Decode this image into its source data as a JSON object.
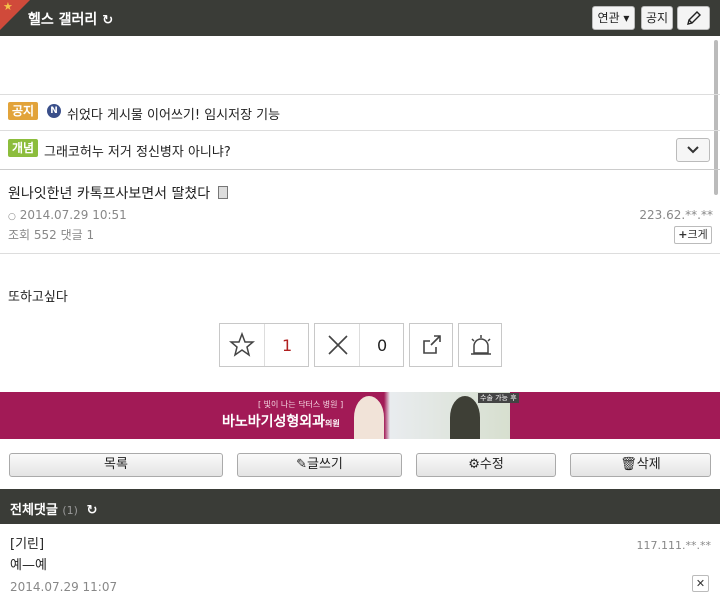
{
  "header": {
    "title": "헬스 갤러리",
    "related_label": "연관 ▾",
    "notice_label": "공지"
  },
  "notice": {
    "badge": "공지",
    "icon_letter": "N",
    "text": "쉬었다 게시물 이어쓰기! 임시저장 기능"
  },
  "concept": {
    "badge": "개념",
    "text": "그래코허누 저거 정신병자 아니냐?"
  },
  "post": {
    "title": "원나잇한년 카톡프사보면서 딸쳤다",
    "date": "2014.07.29 10:51",
    "ip": "223.62.**.**",
    "stats": "조회 552 댓글 1",
    "enlarge_label": "크게",
    "body": "또하고싶다"
  },
  "votes": {
    "recommend_count": "1",
    "reject_count": "0"
  },
  "banner": {
    "small": "[ 빛이 나는 닥터스 병원 ]",
    "main": "바노바기성형외과",
    "sub": "의원",
    "tag": "수술 가능 후"
  },
  "actions": {
    "list": "목록",
    "write": "글쓰기",
    "edit": "수정",
    "delete": "삭제"
  },
  "comments": {
    "header": "전체댓글",
    "count": "(1)",
    "items": [
      {
        "author": "[기린]",
        "ip": "117.111.**.**",
        "text": "예—예",
        "date": "2014.07.29 11:07"
      }
    ]
  },
  "colors": {
    "header_bg": "#3a3c37",
    "notice_badge": "#e2a33a",
    "concept_badge": "#8cbd3c",
    "banner_bg": "#a21a56"
  }
}
